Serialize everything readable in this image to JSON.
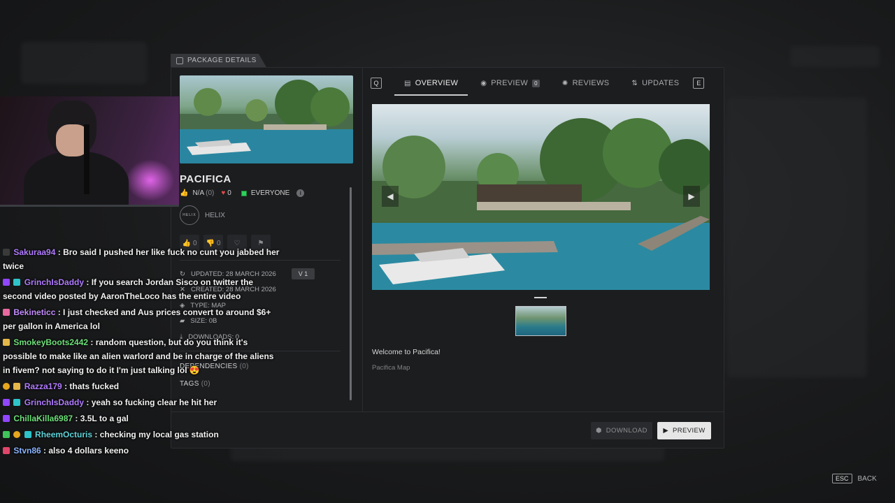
{
  "package": {
    "section_label": "PACKAGE DETAILS",
    "title": "PACIFICA",
    "likes_label": "N/A",
    "likes_count": "(0)",
    "hearts": "0",
    "rating": "EVERYONE",
    "author": "HELIX",
    "author_logo": "HELIX",
    "thumbs_up_count": "0",
    "thumbs_down_count": "0",
    "info": {
      "updated": "UPDATED: 28 MARCH 2026",
      "version": "V 1",
      "created": "CREATED: 28 MARCH 2026",
      "type": "TYPE: MAP",
      "size": "SIZE: 0B",
      "downloads": "DOWNLOADS: 0"
    },
    "dependencies_label": "DEPENDENCIES",
    "dependencies_count": "(0)",
    "tags_label": "TAGS",
    "tags_count": "(0)"
  },
  "tabs": {
    "left_key": "Q",
    "right_key": "E",
    "items": [
      {
        "label": "OVERVIEW",
        "icon": "document-icon"
      },
      {
        "label": "PREVIEW",
        "icon": "eye-icon",
        "count": "0"
      },
      {
        "label": "REVIEWS",
        "icon": "badge-icon"
      },
      {
        "label": "UPDATES",
        "icon": "updates-icon"
      }
    ]
  },
  "overview": {
    "description": "Welcome to Pacifica!",
    "subtitle": "Pacifica Map"
  },
  "footer": {
    "download_label": "DOWNLOAD",
    "preview_label": "PREVIEW",
    "esc_key": "ESC",
    "back_label": "BACK"
  },
  "chat": [
    {
      "user": "Sakuraa94",
      "color": "#b07cff",
      "text": ": Bro said I pushed her like fuck no cunt you jabbed her twice"
    },
    {
      "user": "GrinchIsDaddy",
      "color": "#b07cff",
      "text": ": If you search Jordan Sisco on twitter the second video posted by AaronTheLoco has the entire video"
    },
    {
      "user": "Bekineticc",
      "color": "#c38cff",
      "text": ": I just checked and Aus prices convert to around $6+ per gallon in America lol"
    },
    {
      "user": "SmokeyBoots2442",
      "color": "#6ee07a",
      "text": ": random question, but do you think it's possible to make like an alien warlord and be in charge of the aliens in fivem? not saying to do it I'm just talking lol 😍"
    },
    {
      "user": "Razza179",
      "color": "#b07cff",
      "text": ": thats fucked"
    },
    {
      "user": "GrinchIsDaddy",
      "color": "#b07cff",
      "text": ": yeah so fucking clear he hit her"
    },
    {
      "user": "ChillaKilla6987",
      "color": "#6ee07a",
      "text": ": 3.5L to a gal"
    },
    {
      "user": "RheemOcturis",
      "color": "#5fd3d9",
      "text": ": checking my local gas station"
    },
    {
      "user": "Stvn86",
      "color": "#8ab4ff",
      "text": ": also 4 dollars keeno"
    }
  ]
}
